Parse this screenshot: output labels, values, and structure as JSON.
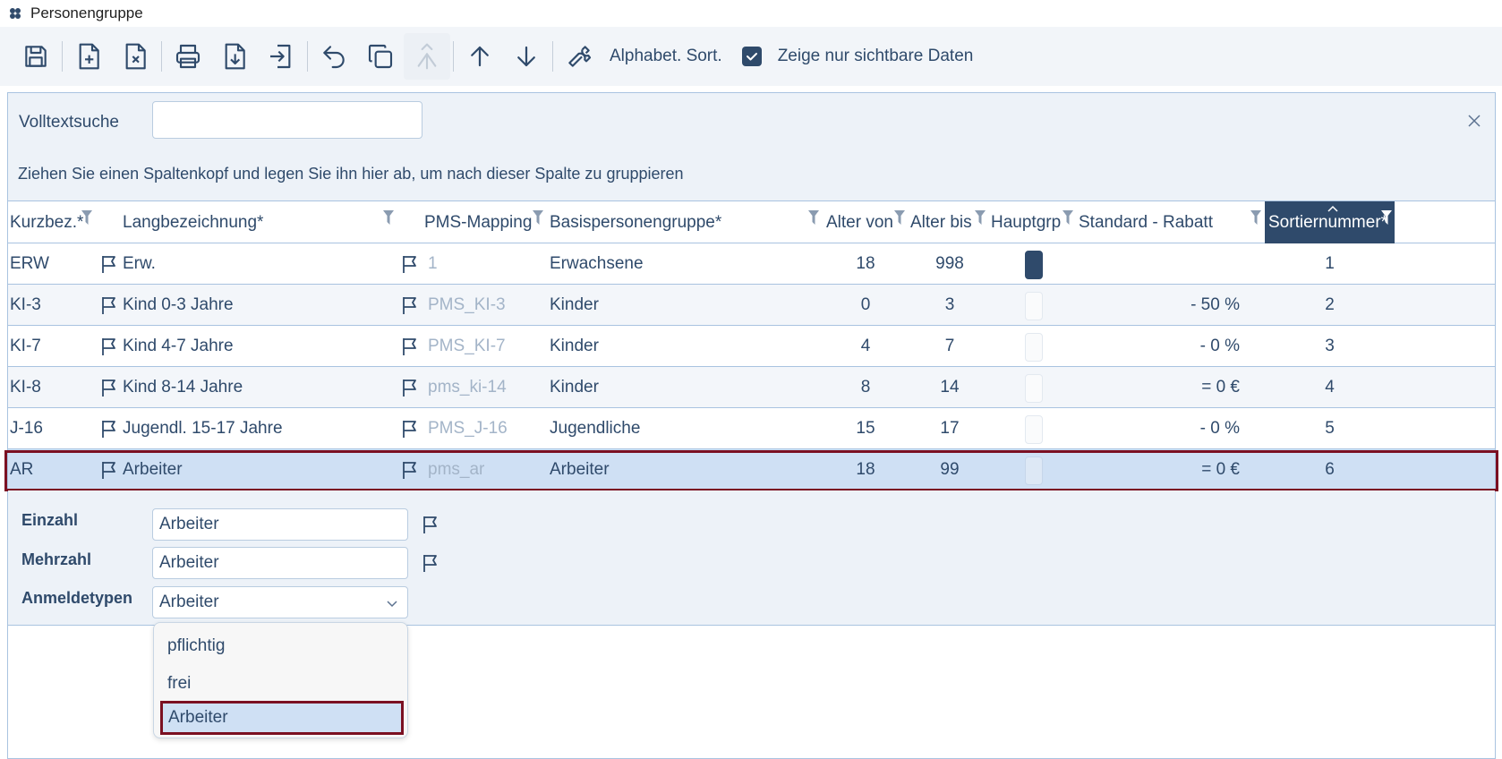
{
  "window": {
    "title": "Personengruppe"
  },
  "toolbar": {
    "alpha_sort_label": "Alphabet. Sort.",
    "visible_only_label": "Zeige nur sichtbare Daten",
    "visible_only_checked": true,
    "icons": [
      "save-icon",
      "add-document-icon",
      "delete-document-icon",
      "print-icon",
      "download-icon",
      "export-icon",
      "undo-icon",
      "copy-icon",
      "merge-icon",
      "arrow-up-icon",
      "arrow-down-icon",
      "wrench-icon"
    ]
  },
  "search": {
    "label": "Volltextsuche",
    "value": "",
    "placeholder": ""
  },
  "group_hint": "Ziehen Sie einen Spaltenkopf und legen Sie ihn hier ab, um nach dieser Spalte zu gruppieren",
  "columns": {
    "kurzbez": "Kurzbez.*",
    "langbez": "Langbezeichnung*",
    "pms": "PMS-Mapping",
    "basis": "Basispersonengruppe*",
    "alter_von": "Alter von",
    "alter_bis": "Alter bis",
    "hauptgrp": "Hauptgrp",
    "rabatt": "Standard - Rabatt",
    "sort": "Sortiernummer*"
  },
  "rows": [
    {
      "kurzbez": "ERW",
      "langbez": "Erw.",
      "pms": "1",
      "basis": "Erwachsene",
      "alter_von": "18",
      "alter_bis": "998",
      "hauptgrp": true,
      "rabatt": "",
      "sort": "1"
    },
    {
      "kurzbez": "KI-3",
      "langbez": "Kind 0-3 Jahre",
      "pms": "PMS_KI-3",
      "basis": "Kinder",
      "alter_von": "0",
      "alter_bis": "3",
      "hauptgrp": false,
      "rabatt": "- 50 %",
      "sort": "2"
    },
    {
      "kurzbez": "KI-7",
      "langbez": "Kind 4-7 Jahre",
      "pms": "PMS_KI-7",
      "basis": "Kinder",
      "alter_von": "4",
      "alter_bis": "7",
      "hauptgrp": false,
      "rabatt": "- 0 %",
      "sort": "3"
    },
    {
      "kurzbez": "KI-8",
      "langbez": "Kind 8-14 Jahre",
      "pms": "pms_ki-14",
      "basis": "Kinder",
      "alter_von": "8",
      "alter_bis": "14",
      "hauptgrp": false,
      "rabatt": "= 0 €",
      "sort": "4"
    },
    {
      "kurzbez": "J-16",
      "langbez": "Jugendl. 15-17 Jahre",
      "pms": "PMS_J-16",
      "basis": "Jugendliche",
      "alter_von": "15",
      "alter_bis": "17",
      "hauptgrp": false,
      "rabatt": "- 0 %",
      "sort": "5"
    },
    {
      "kurzbez": "AR",
      "langbez": "Arbeiter",
      "pms": "pms_ar",
      "basis": "Arbeiter",
      "alter_von": "18",
      "alter_bis": "99",
      "hauptgrp": false,
      "rabatt": "= 0 €",
      "sort": "6"
    }
  ],
  "detail": {
    "einzahl_label": "Einzahl",
    "einzahl_value": "Arbeiter",
    "mehrzahl_label": "Mehrzahl",
    "mehrzahl_value": "Arbeiter",
    "anmeldetypen_label": "Anmeldetypen",
    "anmeldetypen_value": "Arbeiter"
  },
  "dropdown": {
    "options": [
      "pflichtig",
      "frei",
      "Arbeiter"
    ],
    "selected": "Arbeiter"
  },
  "colors": {
    "accent": "#2f4a6b",
    "selection": "#cfe0f4",
    "highlight_border": "#7b1022"
  }
}
